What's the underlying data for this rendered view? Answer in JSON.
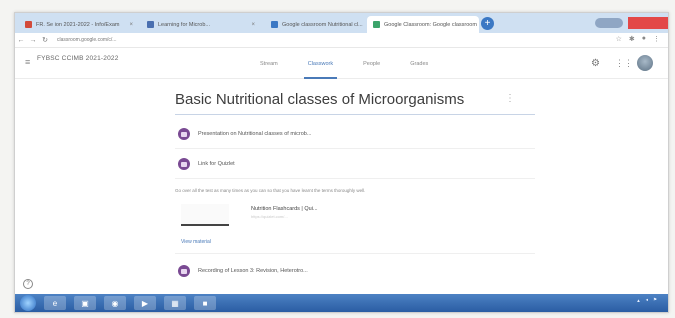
{
  "browser": {
    "tabs": [
      {
        "label": "FR. Se ion 2021-2022 - Info/Exam",
        "color": "#d24a3a"
      },
      {
        "label": "Learning for Microb...",
        "color": "#4a6fb0"
      },
      {
        "label": "Google classroom Nutritional cl...",
        "color": "#3b78c4"
      },
      {
        "label": "Google Classroom: Google classroom",
        "color": "#3ca46b"
      }
    ],
    "url": "classroom.google.com/c/..."
  },
  "app": {
    "class_title": "FYBSC CCIMB 2021-2022",
    "nav": {
      "stream": "Stream",
      "classwork": "Classwork",
      "people": "People",
      "grades": "Grades"
    }
  },
  "topic": {
    "title": "Basic Nutritional classes of Microorganisms",
    "items": [
      {
        "title": "Presentation on Nutritional classes of microb...",
        "date": ""
      },
      {
        "title": "Link for Quizlet",
        "date": ""
      }
    ],
    "description": "Go over all the test as many times as you can so that you have learnt the terms thoroughly well.",
    "attachment": {
      "title": "Nutrition Flashcards | Qui...",
      "url": "https://quizlet.com/..."
    },
    "view_material": "View material",
    "last_item": {
      "title": "Recording of Lesson 3: Revision, Heterotro..."
    }
  },
  "colors": {
    "accent": "#4a7ab8",
    "assignment_icon": "#7a4a93"
  }
}
